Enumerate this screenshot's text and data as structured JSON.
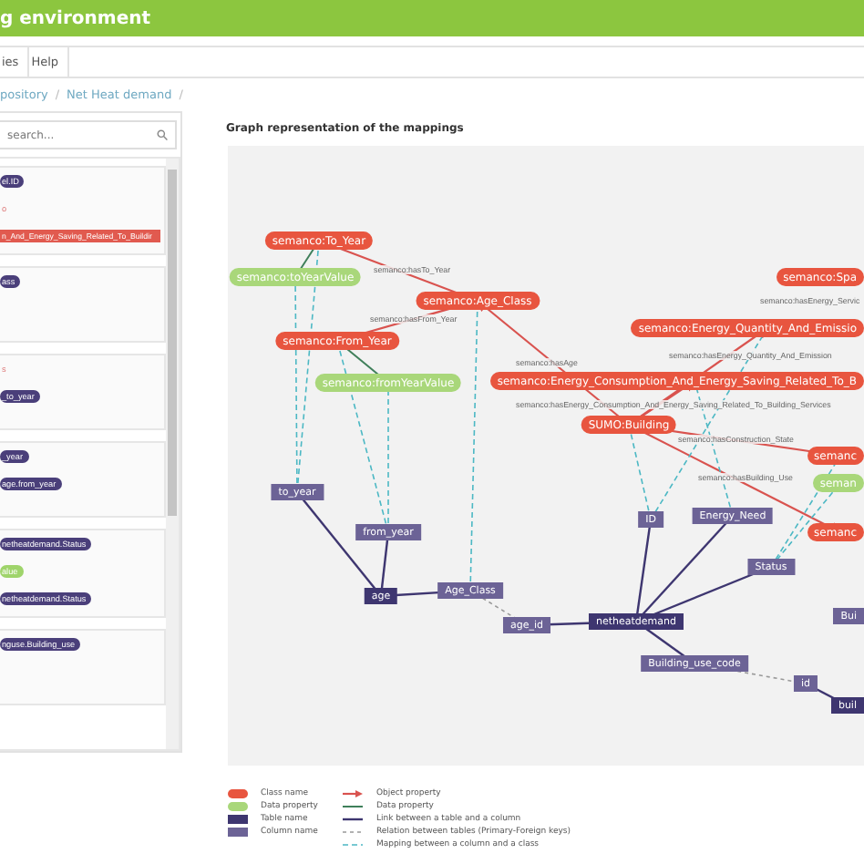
{
  "header": {
    "title": "g environment"
  },
  "menu": [
    {
      "label": "ies"
    },
    {
      "label": "Help"
    }
  ],
  "breadcrumb": {
    "separator": "/",
    "items": [
      {
        "label": "pository"
      },
      {
        "label": "Net Heat demand"
      }
    ]
  },
  "search": {
    "placeholder": "search..."
  },
  "cards": [
    {
      "tags": [
        {
          "kind": "column",
          "text": "el.ID"
        },
        {
          "kind": "text",
          "text": "o"
        },
        {
          "kind": "class",
          "text": "n_And_Energy_Saving_Related_To_Buildir"
        }
      ]
    },
    {
      "tags": [
        {
          "kind": "column",
          "text": "ass"
        }
      ]
    },
    {
      "tags": [
        {
          "kind": "text",
          "text": "s"
        },
        {
          "kind": "column",
          "text": "_to_year"
        }
      ]
    },
    {
      "tags": [
        {
          "kind": "column",
          "text": "_year"
        },
        {
          "kind": "column",
          "text": "age.from_year"
        }
      ]
    },
    {
      "tags": [
        {
          "kind": "column",
          "text": "netheatdemand.Status"
        },
        {
          "kind": "data",
          "text": "alue"
        },
        {
          "kind": "column",
          "text": "netheatdemand.Status"
        }
      ]
    },
    {
      "tags": [
        {
          "kind": "column",
          "text": "nguse.Building_use"
        }
      ]
    }
  ],
  "graph": {
    "title": "Graph representation of the mappings",
    "nodes": [
      {
        "kind": "class",
        "label": "semanco:To_Year"
      },
      {
        "kind": "class",
        "label": "semanco:Age_Class"
      },
      {
        "kind": "class",
        "label": "semanco:From_Year"
      },
      {
        "kind": "class",
        "label": "semanco:Spa"
      },
      {
        "kind": "class",
        "label": "semanco:Energy_Quantity_And_Emissio"
      },
      {
        "kind": "class",
        "label": "semanco:Energy_Consumption_And_Energy_Saving_Related_To_B"
      },
      {
        "kind": "class",
        "label": "SUMO:Building"
      },
      {
        "kind": "class",
        "label": "semanc"
      },
      {
        "kind": "class",
        "label": "semanc"
      },
      {
        "kind": "data",
        "label": "semanco:toYearValue"
      },
      {
        "kind": "data",
        "label": "semanco:fromYearValue"
      },
      {
        "kind": "data",
        "label": "seman"
      },
      {
        "kind": "column",
        "label": "to_year"
      },
      {
        "kind": "column",
        "label": "from_year"
      },
      {
        "kind": "column",
        "label": "Age_Class"
      },
      {
        "kind": "column",
        "label": "age_id"
      },
      {
        "kind": "column",
        "label": "ID"
      },
      {
        "kind": "column",
        "label": "Energy_Need"
      },
      {
        "kind": "column",
        "label": "Status"
      },
      {
        "kind": "column",
        "label": "Building_use_code"
      },
      {
        "kind": "column",
        "label": "id"
      },
      {
        "kind": "column",
        "label": "Bui"
      },
      {
        "kind": "table",
        "label": "age"
      },
      {
        "kind": "table",
        "label": "netheatdemand"
      },
      {
        "kind": "table",
        "label": "buil"
      }
    ],
    "edge_labels": [
      "semanco:hasTo_Year",
      "semanco:hasEnergy_Servic",
      "semanco:hasFrom_Year",
      "semanco:hasEnergy_Quantity_And_Emission",
      "semanco:hasAge",
      "semanco:hasEnergy_Consumption_And_Energy_Saving_Related_To_Building_Services",
      "semanco:hasConstruction_State",
      "semanco:hasBuilding_Use"
    ]
  },
  "legend": [
    {
      "items": [
        {
          "kind": "class",
          "label": "Class name"
        },
        {
          "kind": "data",
          "label": "Data property"
        },
        {
          "kind": "table",
          "label": "Table name"
        },
        {
          "kind": "column",
          "label": "Column name"
        }
      ]
    },
    {
      "items": [
        {
          "kind": "object-line",
          "label": "Object property"
        },
        {
          "kind": "data-line",
          "label": "Data property"
        },
        {
          "kind": "link-line",
          "label": "Link between a table and a column"
        },
        {
          "kind": "fk-line",
          "label": "Relation between tables (Primary-Foreign keys)"
        },
        {
          "kind": "map-line",
          "label": "Mapping between a column and a class"
        }
      ]
    }
  ]
}
